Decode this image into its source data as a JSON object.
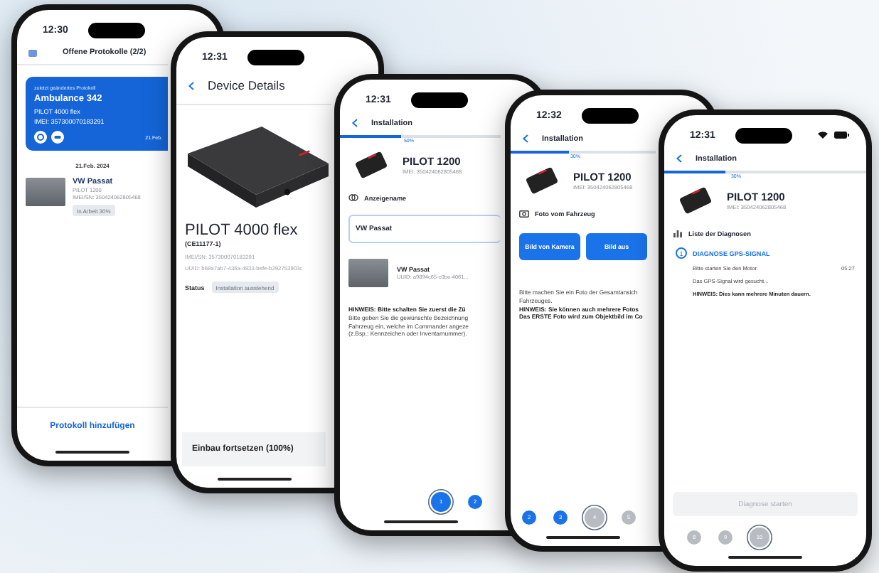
{
  "phones": [
    {
      "kind": "list",
      "time": "12:30",
      "title": "Offene Protokolle (2/2)",
      "recent": {
        "caption": "zuletzt geändertes Protokoll",
        "name": "Ambulance 342",
        "device": "PILOT 4000 flex",
        "imei": "IMEI: 357300070183291",
        "date": "21.Feb."
      },
      "date": "21.Feb. 2024",
      "items": [
        {
          "name": "VW Passat",
          "device": "PILOT 1200",
          "imei": "IMEI/SN: 350424062805468",
          "status": "In Arbeit 30%"
        }
      ],
      "action": "Protokoll hinzufügen"
    },
    {
      "kind": "device",
      "time": "12:31",
      "title": "Device Details",
      "name": "PILOT 4000 flex",
      "code": "(CE11177-1)",
      "imei": "IMEI/SN: 357300070183291",
      "uuid": "UUID: b69a7ab7-436a-4833-befe-b292753903c",
      "status_label": "Status",
      "status": "Installation ausstehend",
      "action": "Einbau fortsetzen (100%)"
    },
    {
      "kind": "install",
      "time": "12:31",
      "title": "Installation",
      "progress": {
        "level": 0.38,
        "label": "50%"
      },
      "device": {
        "name": "PILOT 1200",
        "imei": "IMEI: 350424062805468"
      },
      "section": {
        "kind": "name",
        "label": "Anzeigename"
      },
      "field": {
        "value": "VW Passat"
      },
      "vehicle": {
        "name": "VW Passat",
        "uuid": "UUID: a9894c65-c0be-4061..."
      },
      "notes": [
        {
          "text": "HINWEIS: Bitte schalten Sie zuerst die Zü",
          "bold": true
        },
        {
          "text": "Bitte geben Sie die gewünschte Bezeichnung",
          "bold": false
        },
        {
          "text": "Fahrzeug ein, welche im Commander angeze",
          "bold": false
        },
        {
          "text": "(z.Bsp.: Kennzeichen oder Inventarnummer).",
          "bold": false
        }
      ],
      "steps": [
        {
          "label": "1",
          "selected": true,
          "done": true
        },
        {
          "label": "2",
          "selected": false,
          "done": true
        }
      ]
    },
    {
      "kind": "install",
      "time": "12:32",
      "title": "Installation",
      "progress": {
        "level": 0.4,
        "label": "30%"
      },
      "device": {
        "name": "PILOT 1200",
        "imei": "IMEI: 350424062805468"
      },
      "section": {
        "kind": "photo",
        "label": "Foto vom Fahrzeug"
      },
      "buttons": [
        "Bild von Kamera",
        "Bild aus"
      ],
      "notes": [
        {
          "text": "Bitte machen Sie ein Foto der Gesamtansich",
          "bold": false
        },
        {
          "text": "Fahrzeuges.",
          "bold": false
        },
        {
          "text": "HINWEIS: Sie können auch mehrere Fotos",
          "bold": true
        },
        {
          "text": "Das ERSTE Foto wird zum Objektbild im Co",
          "bold": true
        }
      ],
      "steps": [
        {
          "label": "2",
          "selected": false,
          "done": true
        },
        {
          "label": "3",
          "selected": false,
          "done": true
        },
        {
          "label": "4",
          "selected": true,
          "done": false
        },
        {
          "label": "5",
          "selected": false,
          "done": false
        }
      ]
    },
    {
      "kind": "install",
      "time": "12:31",
      "title": "Installation",
      "progress": {
        "level": 0.3,
        "label": "30%"
      },
      "device": {
        "name": "PILOT 1200",
        "imei": "IMEI: 350424062805468"
      },
      "section": {
        "kind": "diagnosis",
        "label": "Liste der Diagnosen"
      },
      "diagnosis": {
        "number": "1",
        "title": "DIAGNOSE GPS-SIGNAL",
        "time": "05:27",
        "lines": [
          {
            "text": "Bitte starten Sie den Motor.",
            "bold": false
          },
          {
            "text": "Das GPS-Signal wird gesucht...",
            "bold": false
          },
          {
            "text": "HINWEIS: Dies kann mehrere Minuten dauern.",
            "bold": true
          }
        ]
      },
      "action": {
        "label": "Diagnose starten",
        "disabled": true
      },
      "steps": [
        {
          "label": "8",
          "selected": false,
          "done": false
        },
        {
          "label": "9",
          "selected": false,
          "done": false
        },
        {
          "label": "10",
          "selected": true,
          "done": false
        }
      ]
    }
  ]
}
